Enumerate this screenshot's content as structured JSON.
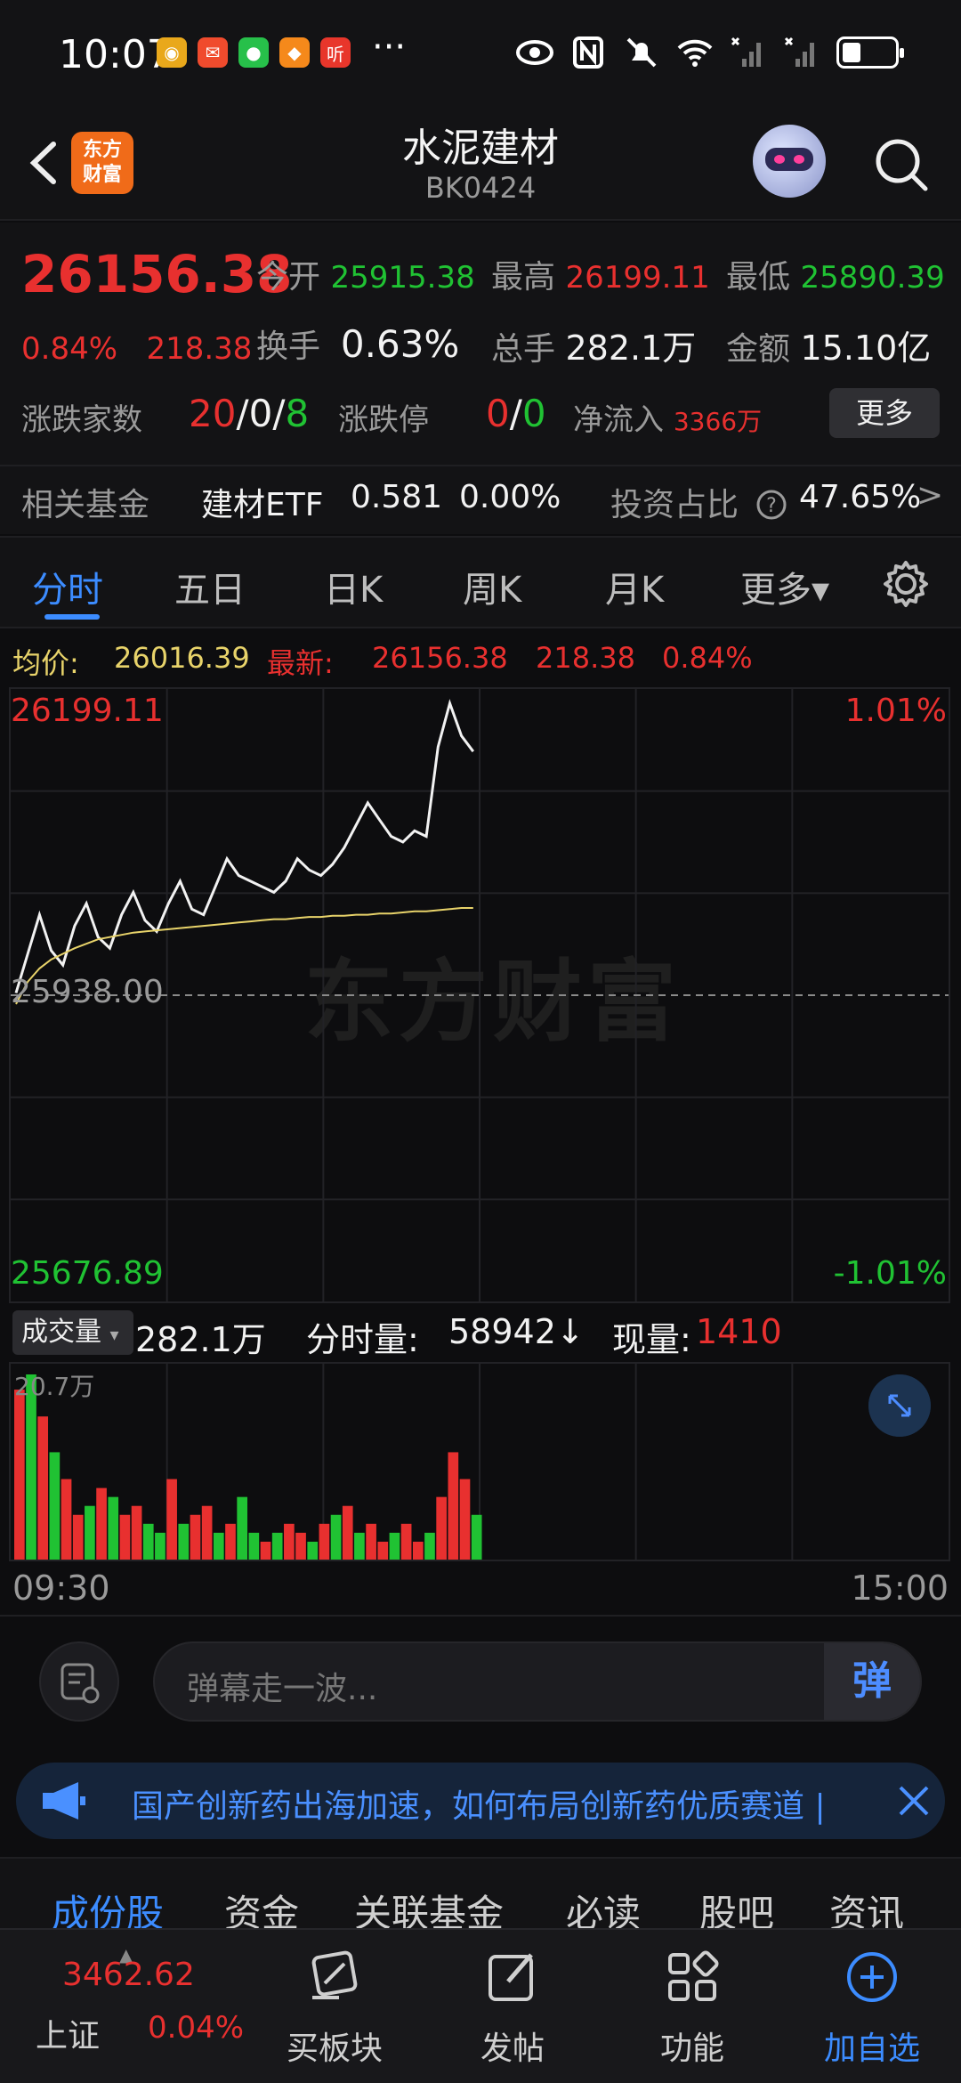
{
  "status_bar": {
    "time": "10:07",
    "more": "···",
    "battery_level": 0.35
  },
  "header": {
    "title": "水泥建材",
    "code": "BK0424",
    "logo_text": "东方\n财富"
  },
  "quote": {
    "price": "26156.38",
    "change_pct": "0.84%",
    "change": "218.38",
    "open_label": "今开",
    "open": "25915.38",
    "high_label": "最高",
    "high": "26199.11",
    "low_label": "最低",
    "low": "25890.39",
    "turnover_label": "换手",
    "turnover": "0.63%",
    "volume_label": "总手",
    "volume": "282.1万",
    "amount_label": "金额",
    "amount": "15.10亿",
    "updown_label": "涨跌家数",
    "up": "20",
    "flat": "0",
    "down": "8",
    "limit_label": "涨跌停",
    "limit_up": "0",
    "limit_down": "0",
    "netflow_label": "净流入",
    "netflow": "3366万",
    "more_label": "更多"
  },
  "fund": {
    "label": "相关基金",
    "name": "建材ETF",
    "price": "0.581",
    "change": "0.00%",
    "ratio_label": "投资占比",
    "ratio": "47.65%"
  },
  "tabs": [
    "分时",
    "五日",
    "日K",
    "周K",
    "月K",
    "更多▾"
  ],
  "info": {
    "avg_label": "均价:",
    "avg": "26016.39",
    "latest_label": "最新:",
    "latest": "26156.38",
    "change": "218.38",
    "pct": "0.84%"
  },
  "chart_data": {
    "type": "line",
    "title": "",
    "y_top": "26199.11",
    "y_mid": "25938.00",
    "y_bottom": "25676.89",
    "pct_top": "1.01%",
    "pct_bottom": "-1.01%",
    "ylim": [
      25676.89,
      26199.11
    ],
    "x_start": "09:30",
    "x_end": "15:00",
    "watermark": "东方财富",
    "total_minutes": 240,
    "series": [
      {
        "values": [
          25940,
          25975,
          26010,
          25978,
          25965,
          26000,
          26020,
          25990,
          25980,
          26010,
          26030,
          26005,
          25995,
          26020,
          26040,
          26015,
          26010,
          26035,
          26060,
          26045,
          26040,
          26035,
          26030,
          26040,
          26060,
          26050,
          26045,
          26055,
          26070,
          26090,
          26110,
          26095,
          26080,
          26075,
          26085,
          26080,
          26160,
          26199,
          26170,
          26156
        ]
      },
      {
        "values": [
          25930,
          25950,
          25962,
          25970,
          25975,
          25980,
          25984,
          25988,
          25990,
          25992,
          25994,
          25995,
          25996,
          25997,
          25998,
          25999,
          26000,
          26001,
          26002,
          26003,
          26004,
          26005,
          26006,
          26006,
          26007,
          26008,
          26008,
          26009,
          26009,
          26010,
          26010,
          26011,
          26011,
          26012,
          26013,
          26013,
          26014,
          26015,
          26016,
          26016
        ]
      }
    ]
  },
  "volume": {
    "label": "成交量",
    "total": "282.1万",
    "minute_label": "分时量:",
    "minute": "58942↓",
    "now_label": "现量:",
    "now": "1410",
    "max": "20.7万",
    "bars": [
      19,
      20.7,
      16,
      12,
      9,
      5,
      6,
      8,
      7,
      5,
      6,
      4,
      3,
      9,
      4,
      5,
      6,
      3,
      4,
      7,
      3,
      2,
      3,
      4,
      3,
      2,
      4,
      5,
      6,
      3,
      4,
      2,
      3,
      4,
      2,
      3,
      7,
      12,
      9,
      5
    ],
    "up": [
      1,
      0,
      1,
      0,
      1,
      1,
      0,
      1,
      0,
      1,
      1,
      0,
      0,
      1,
      0,
      1,
      1,
      0,
      1,
      0,
      0,
      1,
      0,
      1,
      1,
      0,
      1,
      0,
      1,
      0,
      1,
      1,
      0,
      1,
      1,
      0,
      1,
      1,
      1,
      0
    ]
  },
  "comment": {
    "placeholder": "弹幕走一波...",
    "send": "弹"
  },
  "banner": {
    "text": "国产创新药出海加速，如何布局创新药优质赛道 |"
  },
  "bottom_tabs": [
    "成份股",
    "资金",
    "关联基金",
    "必读",
    "股吧",
    "资讯"
  ],
  "bottom_nav": {
    "index_value": "3462.62",
    "index_name": "上证",
    "index_pct": "0.04%",
    "buy": "买板块",
    "post": "发帖",
    "func": "功能",
    "add": "加自选"
  }
}
